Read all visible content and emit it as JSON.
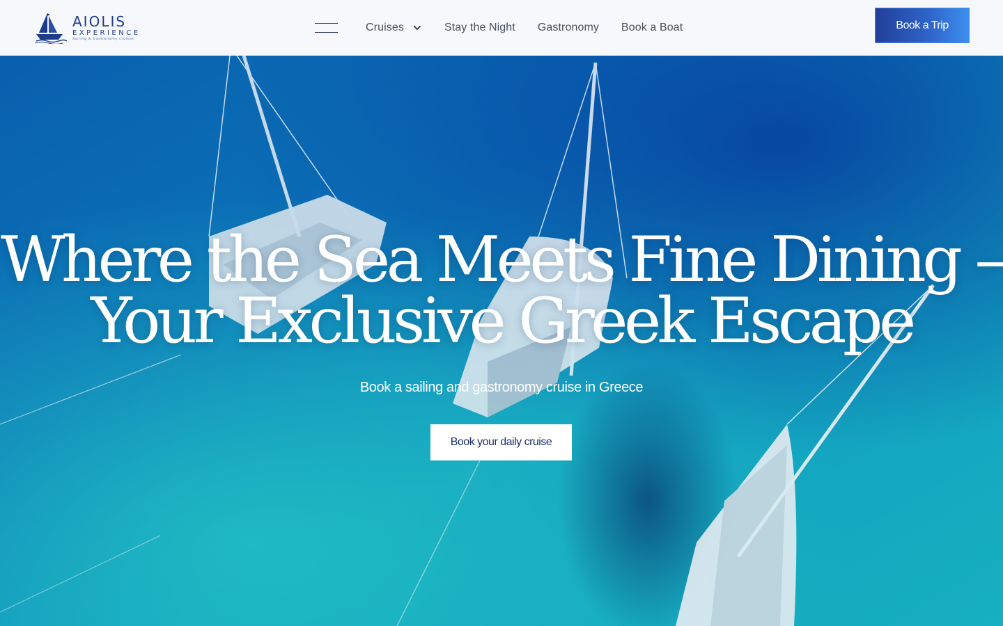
{
  "header": {
    "logo": {
      "word": "AIOLIS",
      "sub": "EXPERIENCE",
      "tagline": "Sailing & Gastronomy cruises"
    },
    "nav": {
      "menu_icon": "hamburger-icon",
      "items": [
        {
          "label": "Cruises",
          "has_dropdown": true
        },
        {
          "label": "Stay the Night"
        },
        {
          "label": "Gastronomy"
        },
        {
          "label": "Book a Boat"
        }
      ]
    },
    "cta_label": "Book a Trip"
  },
  "hero": {
    "title_line1": "Where the Sea Meets Fine Dining –",
    "title_line2": "Your Exclusive Greek Escape",
    "subtitle": "Book a sailing and gastronomy cruise in Greece",
    "cta_label": "Book your daily cruise",
    "background": "aerial-sea-yachts-image"
  },
  "colors": {
    "brand": "#1f3b8c",
    "button_gradient_start": "#223f9a",
    "button_gradient_end": "#3c8fee",
    "header_bg": "#f6f8fb",
    "sea_deep": "#0a4fa8",
    "sea_shallow": "#1ab3c2"
  }
}
